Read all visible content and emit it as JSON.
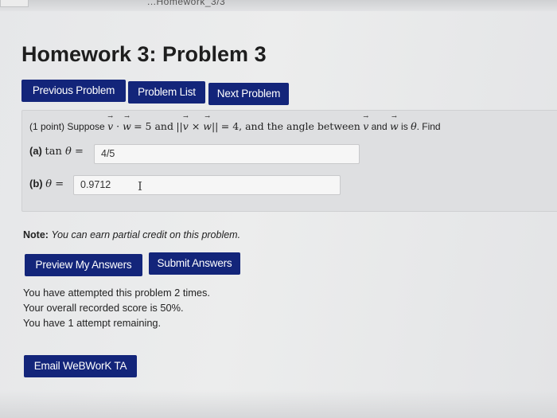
{
  "header": {
    "breadcrumb": "...Homework_3/3",
    "title": "Homework 3: Problem 3"
  },
  "nav": {
    "previous": "Previous Problem",
    "list": "Problem List",
    "next": "Next Problem"
  },
  "problem": {
    "points": "(1 point) Suppose",
    "dot_eq": "= 5 and",
    "norm_eq": "= 4, and the angle between",
    "and": "and",
    "is": "is",
    "find": ". Find",
    "part_a_label": "(a)",
    "part_a_value": "4/5",
    "part_b_label": "(b)",
    "part_b_value": "0.9712",
    "cursor_glyph": "I"
  },
  "note": {
    "label": "Note:",
    "text": "You can earn partial credit on this problem."
  },
  "actions": {
    "preview": "Preview My Answers",
    "submit": "Submit Answers",
    "email": "Email WeBWorK TA"
  },
  "status": {
    "attempted": "You have attempted this problem 2 times.",
    "score": "Your overall recorded score is 50%.",
    "remaining": "You have 1 attempt remaining."
  },
  "colors": {
    "button": "#13257a",
    "page": "#e6e7e9",
    "problem_box": "#dedfe1"
  }
}
